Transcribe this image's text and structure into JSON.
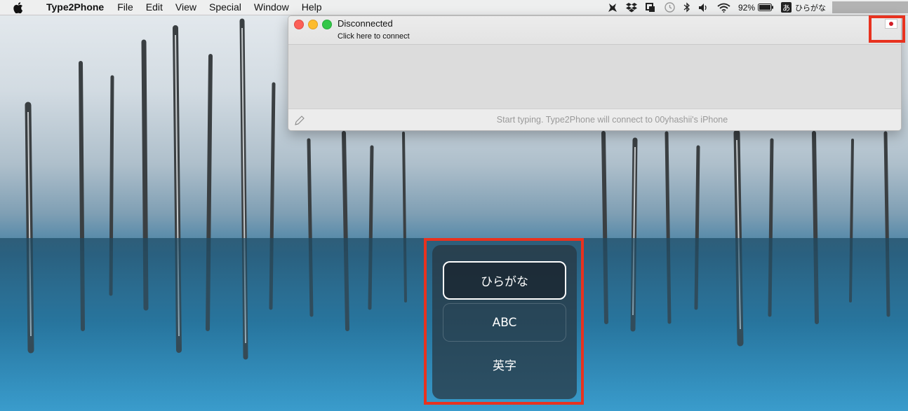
{
  "menubar": {
    "apple_icon": "apple-icon",
    "app_name": "Type2Phone",
    "items": [
      "File",
      "Edit",
      "View",
      "Special",
      "Window",
      "Help"
    ],
    "status": {
      "battery_percent": "92%",
      "input_source_mark": "あ",
      "input_source_label": "ひらがな"
    }
  },
  "window": {
    "title": "Disconnected",
    "subtitle": "Click here to connect",
    "hint": "Start typing. Type2Phone will connect to 00yhashii's iPhone"
  },
  "input_switcher": {
    "options": [
      "ひらがな",
      "ABC",
      "英字"
    ],
    "selected_index": 0
  },
  "colors": {
    "highlight": "#e8321f",
    "flag_red": "#d21f28"
  }
}
